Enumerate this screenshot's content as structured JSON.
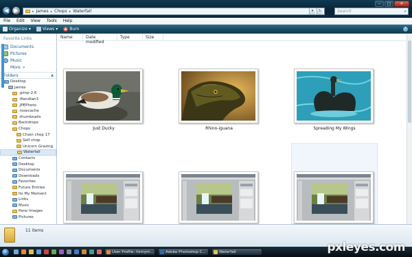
{
  "address_bar": {
    "path": [
      "James",
      "Chops",
      "Waterfall"
    ],
    "search_placeholder": "Search"
  },
  "menu": [
    "File",
    "Edit",
    "View",
    "Tools",
    "Help"
  ],
  "toolbar": {
    "organize": "Organize",
    "views": "Views",
    "burn": "Burn"
  },
  "favorites": {
    "title": "Favorite Links",
    "items": [
      "Documents",
      "Pictures",
      "Music"
    ],
    "more": "More"
  },
  "folders": {
    "title": "Folders",
    "tree": [
      {
        "label": "Desktop",
        "indent": 1,
        "kind": "blue"
      },
      {
        "label": "James",
        "indent": 2,
        "kind": "gray"
      },
      {
        "label": ".gimp-2.6",
        "indent": 3,
        "kind": "yellow"
      },
      {
        "label": ".ifiendian3",
        "indent": 3,
        "kind": "yellow"
      },
      {
        "label": ".JPEPhoto",
        "indent": 3,
        "kind": "yellow"
      },
      {
        "label": ".rosecache",
        "indent": 3,
        "kind": "yellow"
      },
      {
        "label": ".thumbnails",
        "indent": 3,
        "kind": "yellow"
      },
      {
        "label": "Backdrops",
        "indent": 3,
        "kind": "yellow"
      },
      {
        "label": "Chops",
        "indent": 3,
        "kind": "yellow"
      },
      {
        "label": "Chain chop 17",
        "indent": 4,
        "kind": "yellow"
      },
      {
        "label": "Self chop",
        "indent": 4,
        "kind": "yellow"
      },
      {
        "label": "Unicorn Grazing",
        "indent": 4,
        "kind": "yellow"
      },
      {
        "label": "Waterfall",
        "indent": 4,
        "kind": "yellow",
        "selected": true
      },
      {
        "label": "Contacts",
        "indent": 3,
        "kind": "blue"
      },
      {
        "label": "Desktop",
        "indent": 3,
        "kind": "blue"
      },
      {
        "label": "Documents",
        "indent": 3,
        "kind": "blue"
      },
      {
        "label": "Downloads",
        "indent": 3,
        "kind": "blue"
      },
      {
        "label": "Favorites",
        "indent": 3,
        "kind": "blue"
      },
      {
        "label": "Future Entries",
        "indent": 3,
        "kind": "yellow"
      },
      {
        "label": "Its My Moment",
        "indent": 3,
        "kind": "yellow"
      },
      {
        "label": "Links",
        "indent": 3,
        "kind": "blue"
      },
      {
        "label": "Music",
        "indent": 3,
        "kind": "blue"
      },
      {
        "label": "Pano Images",
        "indent": 3,
        "kind": "yellow"
      },
      {
        "label": "Pictures",
        "indent": 3,
        "kind": "blue"
      }
    ]
  },
  "columns": [
    "Name",
    "Date modified",
    "Type",
    "Size"
  ],
  "files": [
    {
      "caption": "Just Ducky",
      "kind": "duck"
    },
    {
      "caption": "Rhino-iguana",
      "kind": "iguana"
    },
    {
      "caption": "Spreading My Wings",
      "kind": "bird"
    },
    {
      "caption": "",
      "kind": "screenshot"
    },
    {
      "caption": "",
      "kind": "screenshot"
    },
    {
      "caption": "",
      "kind": "screenshot"
    }
  ],
  "status": {
    "count": "11 items"
  },
  "taskbar": {
    "tasks": [
      "User Profile: itsmym...",
      "Adobe Photoshop C...",
      "Waterfall"
    ]
  },
  "watermark": "pxleyes.com",
  "colors": {
    "titlebar": "#0b2a3d",
    "toolbar": "#174a62",
    "link": "#1c5c95",
    "taskbar": "#060c12"
  }
}
